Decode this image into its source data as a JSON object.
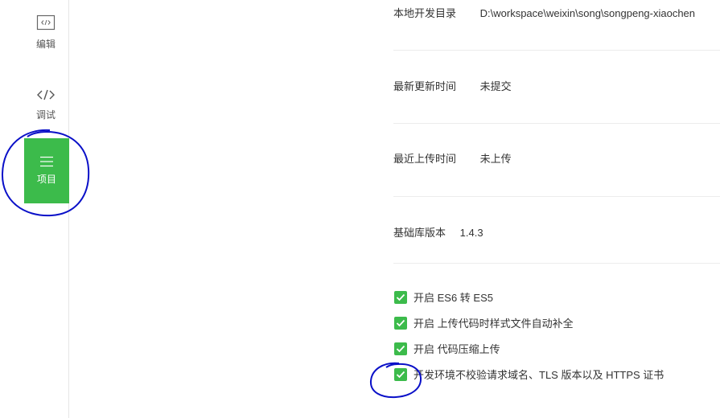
{
  "sidebar": {
    "items": [
      {
        "label": "编辑",
        "icon": "code-file-icon"
      },
      {
        "label": "调试",
        "icon": "code-brackets-icon"
      },
      {
        "label": "项目",
        "icon": "menu-lines-icon",
        "active": true
      }
    ]
  },
  "project": {
    "rows": [
      {
        "label": "本地开发目录",
        "value": "D:\\workspace\\weixin\\song\\songpeng-xiaochen"
      },
      {
        "label": "最新更新时间",
        "value": "未提交"
      },
      {
        "label": "最近上传时间",
        "value": "未上传"
      },
      {
        "label": "基础库版本",
        "value": "1.4.3"
      }
    ],
    "options": [
      {
        "label": "开启 ES6 转 ES5",
        "checked": true
      },
      {
        "label": "开启 上传代码时样式文件自动补全",
        "checked": true
      },
      {
        "label": "开启 代码压缩上传",
        "checked": true
      },
      {
        "label": "开发环境不校验请求域名、TLS 版本以及 HTTPS 证书",
        "checked": true
      }
    ]
  },
  "colors": {
    "accent": "#3cbb4b",
    "annotation": "#0a10c8"
  }
}
